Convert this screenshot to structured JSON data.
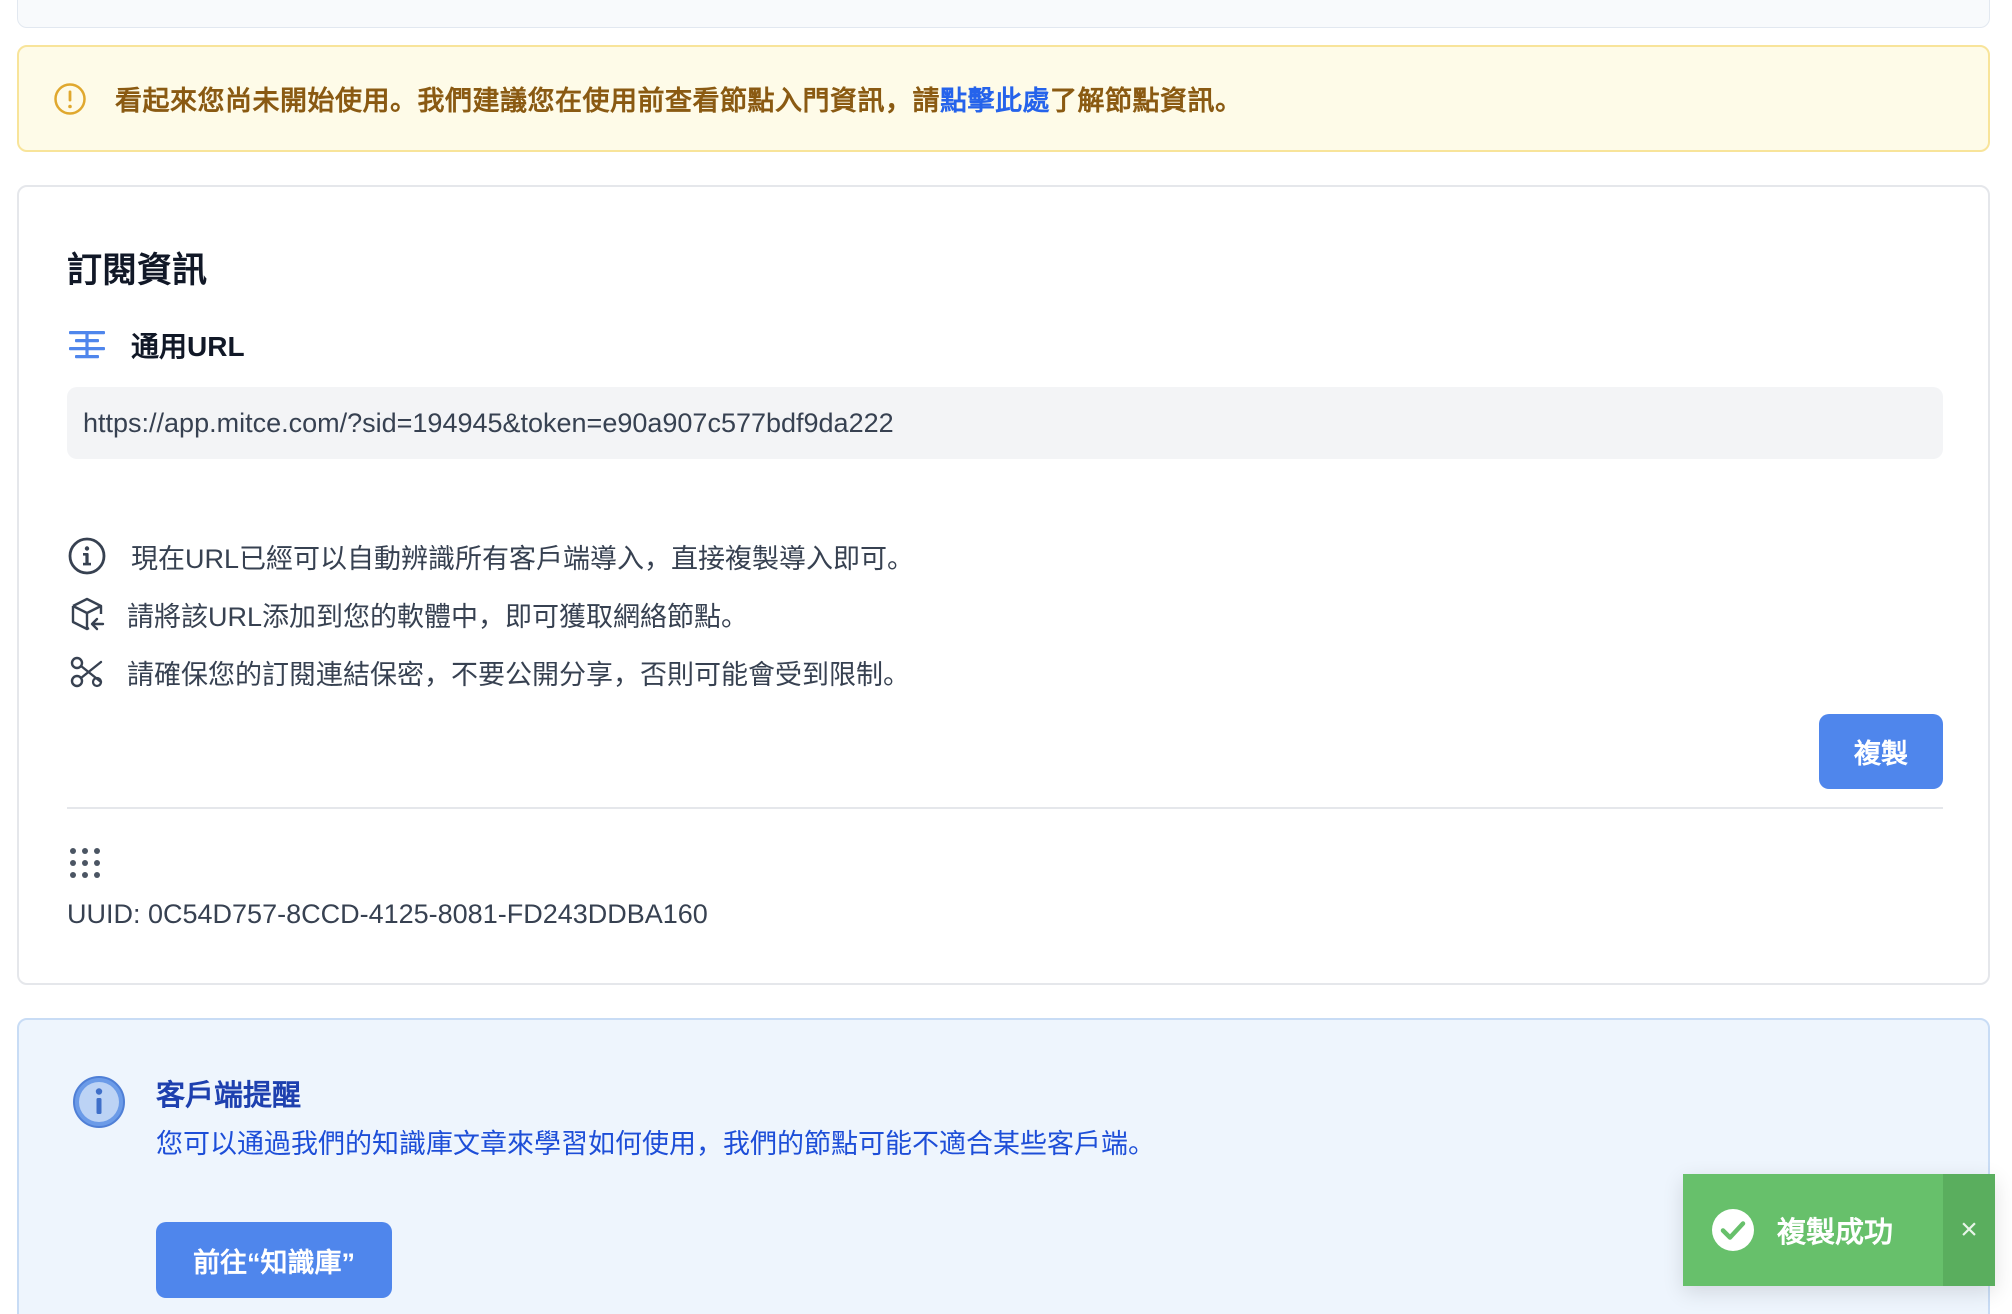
{
  "warning": {
    "text_before": "看起來您尚未開始使用。我們建議您在使用前查看節點入門資訊，請",
    "link_text": "點擊此處",
    "text_after": "了解節點資訊。",
    "icon": "exclamation-circle-icon",
    "color": "#8a5a12"
  },
  "subscription": {
    "title": "訂閱資訊",
    "url_heading": "通用URL",
    "url_icon": "list-icon",
    "url_value": "https://app.mitce.com/?sid=194945&token=e90a907c577bdf9da222",
    "notes": [
      {
        "icon": "info-icon",
        "text": "現在URL已經可以自動辨識所有客戶端導入，直接複製導入即可。"
      },
      {
        "icon": "package-import-icon",
        "text": "請將該URL添加到您的軟體中，即可獲取網絡節點。"
      },
      {
        "icon": "scissors-icon",
        "text": "請確保您的訂閱連結保密，不要公開分享，否則可能會受到限制。"
      }
    ],
    "copy_label": "複製",
    "uuid_icon": "grid-icon",
    "uuid_text": "UUID: 0C54D757-8CCD-4125-8081-FD243DDBA160"
  },
  "client_tip": {
    "icon": "info-circle-icon",
    "title": "客戶端提醒",
    "text": "您可以通過我們的知識庫文章來學習如何使用，我們的節點可能不適合某些客戶端。",
    "button_label": "前往“知識庫”"
  },
  "toast": {
    "icon": "check-circle-icon",
    "message": "複製成功",
    "close_symbol": "×",
    "color": "#67c06b"
  },
  "colors": {
    "accent": "#4f86ec",
    "warning_bg": "#fefbe8",
    "tip_bg": "#eef5fd"
  }
}
